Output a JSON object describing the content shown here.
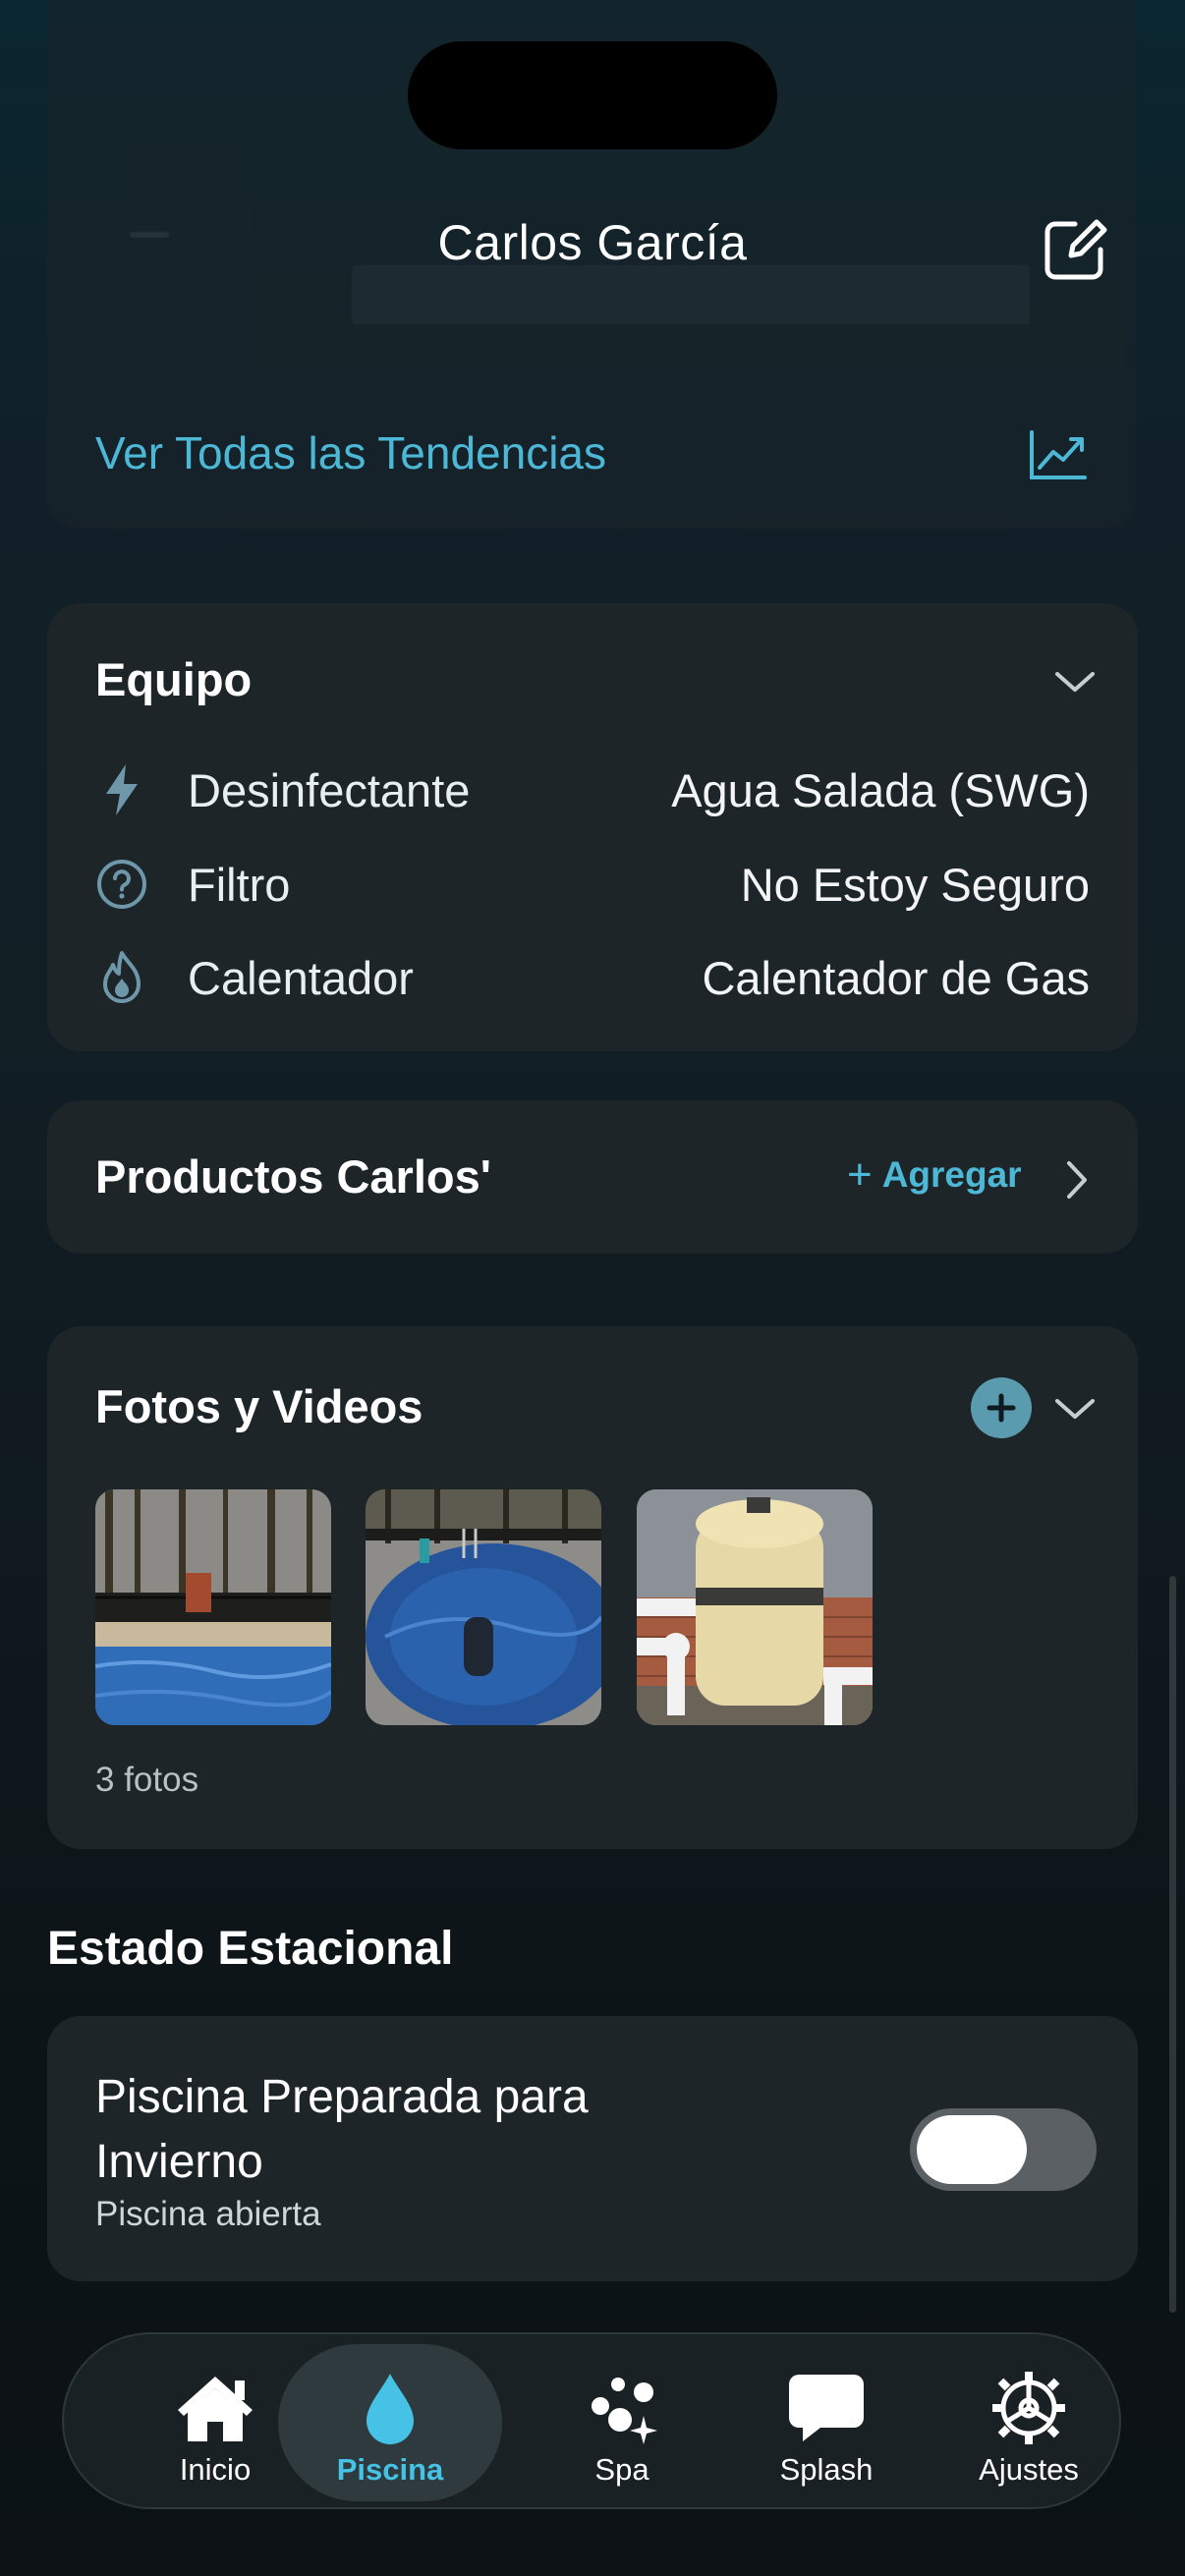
{
  "header": {
    "title": "Carlos García"
  },
  "trends": {
    "link_label": "Ver Todas las Tendencias"
  },
  "equipment": {
    "title": "Equipo",
    "rows": [
      {
        "icon": "lightning-bolt-icon",
        "label": "Desinfectante",
        "value": "Agua Salada (SWG)"
      },
      {
        "icon": "question-circle-icon",
        "label": "Filtro",
        "value": "No Estoy Seguro"
      },
      {
        "icon": "flame-icon",
        "label": "Calentador",
        "value": "Calentador de Gas"
      }
    ]
  },
  "products": {
    "title": "Productos Carlos'",
    "add_label": "Agregar"
  },
  "media": {
    "title": "Fotos y Videos",
    "photos": [
      {
        "description": "pool-with-fence"
      },
      {
        "description": "pool-with-ladder"
      },
      {
        "description": "pool-filter-equipment"
      }
    ],
    "count_label": "3 fotos"
  },
  "seasonal": {
    "section_title": "Estado Estacional",
    "title": "Piscina Preparada para Invierno",
    "subtitle": "Piscina abierta",
    "toggle_on": false
  },
  "tabbar": {
    "tabs": [
      {
        "label": "Inicio",
        "icon": "house-icon",
        "active": false
      },
      {
        "label": "Piscina",
        "icon": "water-drop-icon",
        "active": true
      },
      {
        "label": "Spa",
        "icon": "bubbles-icon",
        "active": false
      },
      {
        "label": "Splash",
        "icon": "chat-bubble-icon",
        "active": false
      },
      {
        "label": "Ajustes",
        "icon": "gear-icon",
        "active": false
      }
    ]
  },
  "colors": {
    "accent": "#4db8d6",
    "card": "#1d2529",
    "active_tab_text": "#45c2e6"
  }
}
